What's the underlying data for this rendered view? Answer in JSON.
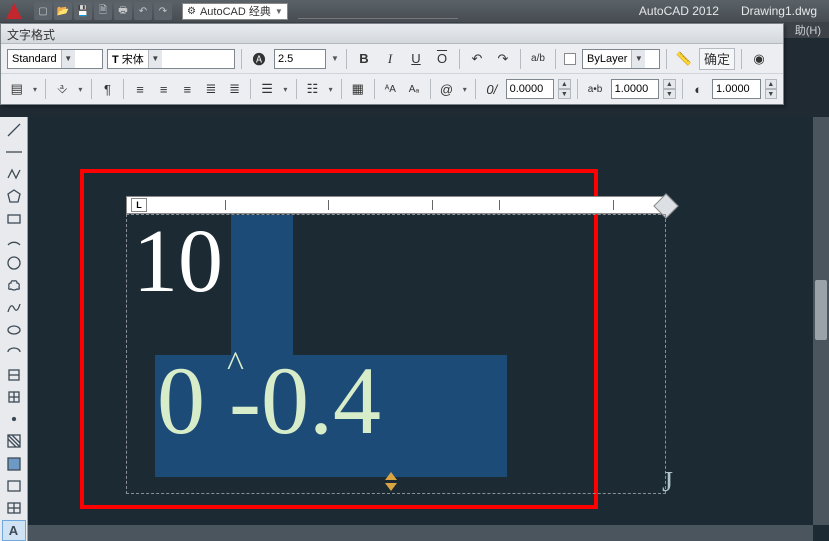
{
  "titlebar": {
    "workspace": "AutoCAD 经典",
    "app_name": "AutoCAD 2012",
    "doc_name": "Drawing1.dwg"
  },
  "menubar": {
    "help": "助(H)"
  },
  "text_format_panel": {
    "title": "文字格式",
    "style": "Standard",
    "font": "宋体",
    "height": "2.5",
    "layer": "ByLayer",
    "ok_label": "确定",
    "tracking": "0.0000",
    "width_factor": "1.0000",
    "oblique": "1.0000"
  },
  "ruler": {
    "tab_type": "L"
  },
  "mtext": {
    "line1": "10",
    "line2_text": "0 -0.4",
    "caret_char": "^"
  },
  "text_cursor_glyph": "J"
}
